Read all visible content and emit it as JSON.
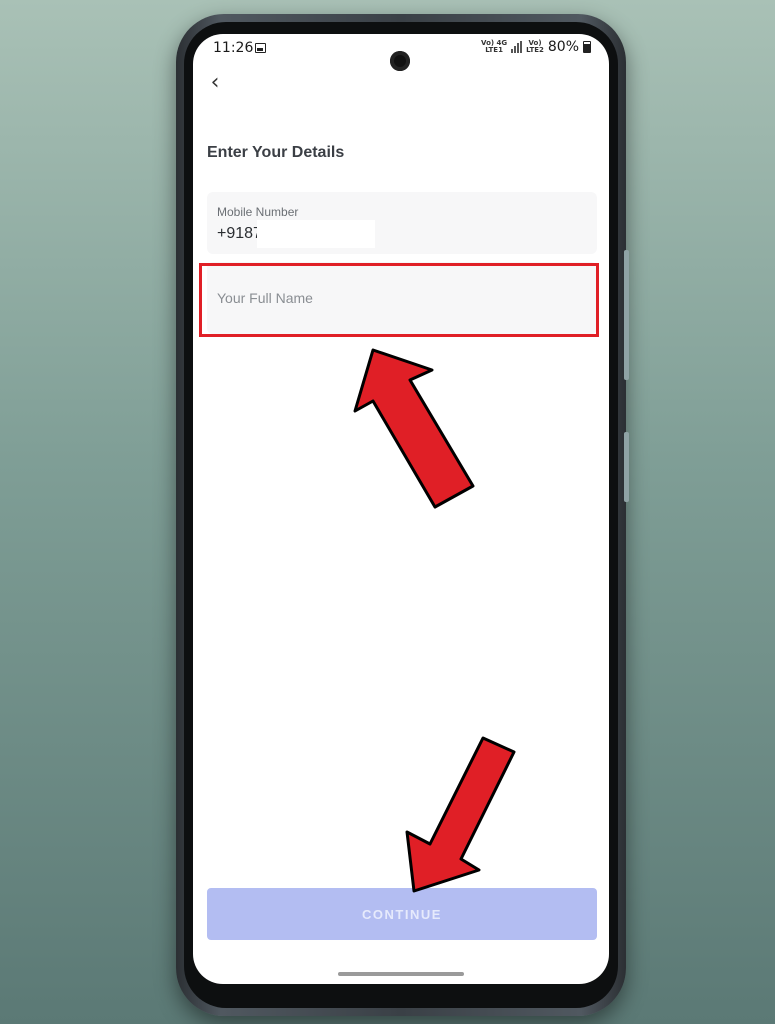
{
  "status_bar": {
    "time": "11:26",
    "network_1": "Vo) 4G\nLTE1",
    "network_2": "Vo)\nLTE2",
    "battery": "80%"
  },
  "header": {
    "back_icon": "chevron-left-icon",
    "title": "Enter Your Details"
  },
  "form": {
    "mobile": {
      "label": "Mobile Number",
      "value": "+9187"
    },
    "full_name": {
      "placeholder": "Your Full Name",
      "value": ""
    },
    "continue_label": "CONTINUE"
  },
  "colors": {
    "annotation_red": "#e01f26",
    "continue_disabled": "#b3bdf2"
  }
}
